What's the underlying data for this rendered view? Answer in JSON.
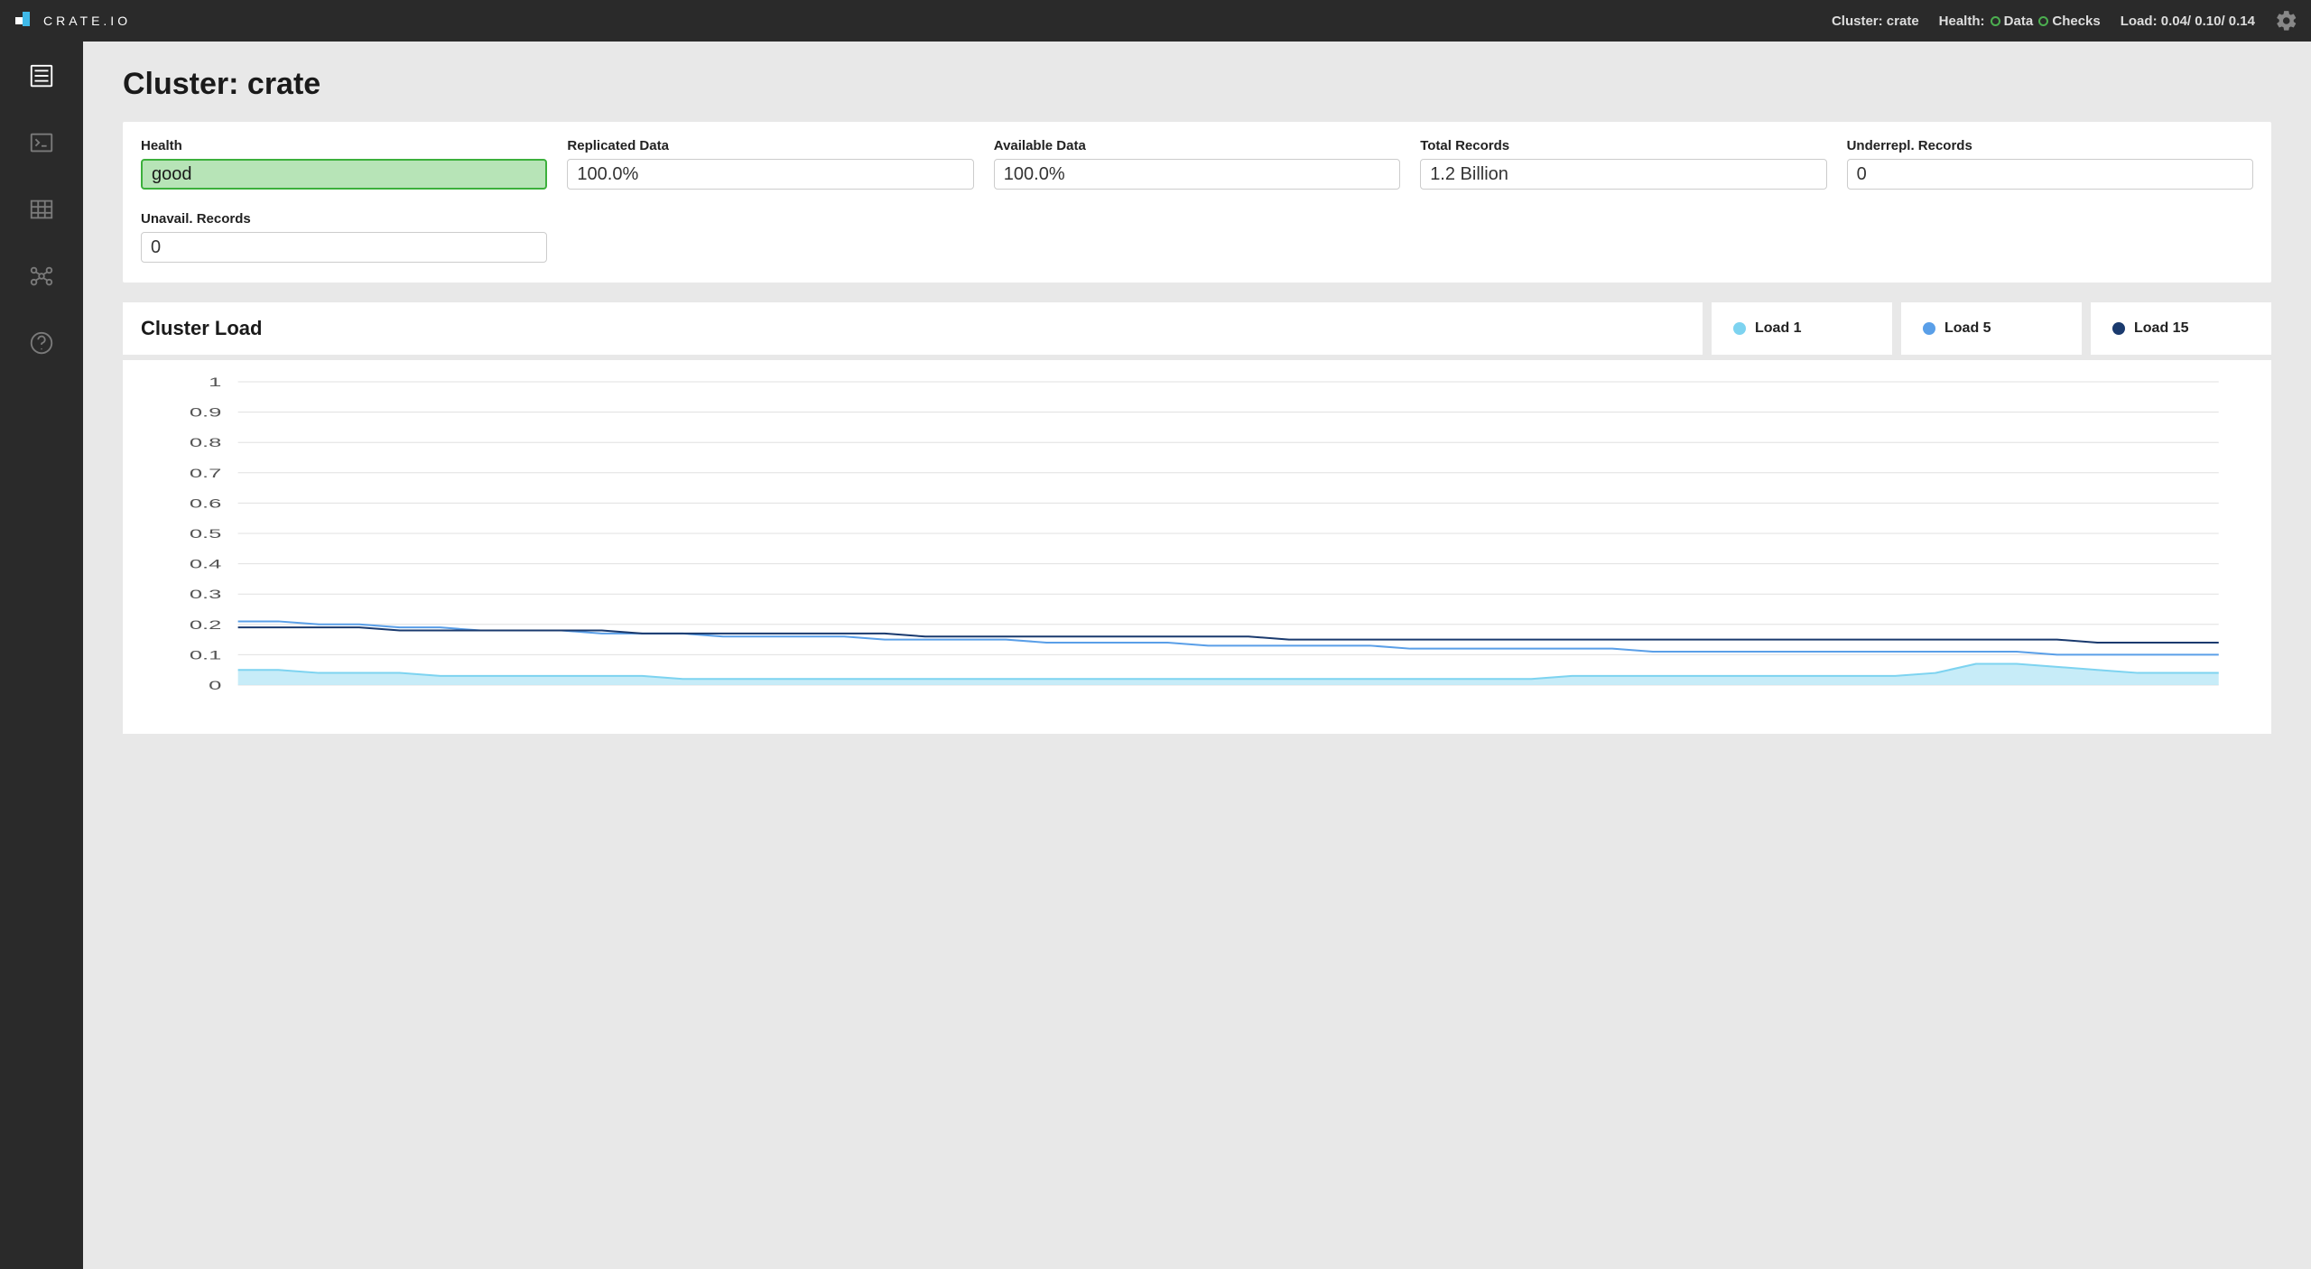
{
  "topbar": {
    "brand": "CRATE.IO",
    "cluster_label": "Cluster:",
    "cluster_name": "crate",
    "health_label": "Health:",
    "health_data": "Data",
    "health_checks": "Checks",
    "load_label": "Load:",
    "load_values": "0.04/ 0.10/ 0.14"
  },
  "sidebar": {
    "items": [
      {
        "name": "overview",
        "icon": "overview-icon",
        "active": true
      },
      {
        "name": "console",
        "icon": "console-icon",
        "active": false
      },
      {
        "name": "tables",
        "icon": "tables-icon",
        "active": false
      },
      {
        "name": "cluster",
        "icon": "cluster-icon",
        "active": false
      },
      {
        "name": "help",
        "icon": "help-icon",
        "active": false
      }
    ]
  },
  "page": {
    "title": "Cluster: crate"
  },
  "stats": [
    {
      "label": "Health",
      "value": "good",
      "kind": "health-good"
    },
    {
      "label": "Replicated Data",
      "value": "100.0%"
    },
    {
      "label": "Available Data",
      "value": "100.0%"
    },
    {
      "label": "Total Records",
      "value": "1.2 Billion"
    },
    {
      "label": "Underrepl. Records",
      "value": "0"
    },
    {
      "label": "Unavail. Records",
      "value": "0"
    }
  ],
  "chart": {
    "title": "Cluster Load",
    "legend": [
      {
        "label": "Load 1",
        "color": "#7dd3f0"
      },
      {
        "label": "Load 5",
        "color": "#5a9fe8"
      },
      {
        "label": "Load 15",
        "color": "#1a3a6e"
      }
    ]
  },
  "chart_data": {
    "type": "line",
    "title": "Cluster Load",
    "ylabel": "",
    "xlabel": "",
    "ylim": [
      0,
      1
    ],
    "yticks": [
      0,
      0.1,
      0.2,
      0.3,
      0.4,
      0.5,
      0.6,
      0.7,
      0.8,
      0.9,
      1
    ],
    "x": [
      0,
      1,
      2,
      3,
      4,
      5,
      6,
      7,
      8,
      9,
      10,
      11,
      12,
      13,
      14,
      15,
      16,
      17,
      18,
      19,
      20,
      21,
      22,
      23,
      24,
      25,
      26,
      27,
      28,
      29,
      30,
      31,
      32,
      33,
      34,
      35,
      36,
      37,
      38,
      39,
      40,
      41,
      42,
      43,
      44,
      45,
      46,
      47,
      48,
      49
    ],
    "series": [
      {
        "name": "Load 1",
        "color": "#7dd3f0",
        "fill": "#bde9f7",
        "values": [
          0.05,
          0.05,
          0.04,
          0.04,
          0.04,
          0.03,
          0.03,
          0.03,
          0.03,
          0.03,
          0.03,
          0.02,
          0.02,
          0.02,
          0.02,
          0.02,
          0.02,
          0.02,
          0.02,
          0.02,
          0.02,
          0.02,
          0.02,
          0.02,
          0.02,
          0.02,
          0.02,
          0.02,
          0.02,
          0.02,
          0.02,
          0.02,
          0.02,
          0.03,
          0.03,
          0.03,
          0.03,
          0.03,
          0.03,
          0.03,
          0.03,
          0.03,
          0.04,
          0.07,
          0.07,
          0.06,
          0.05,
          0.04,
          0.04,
          0.04
        ]
      },
      {
        "name": "Load 5",
        "color": "#5a9fe8",
        "values": [
          0.21,
          0.21,
          0.2,
          0.2,
          0.19,
          0.19,
          0.18,
          0.18,
          0.18,
          0.17,
          0.17,
          0.17,
          0.16,
          0.16,
          0.16,
          0.16,
          0.15,
          0.15,
          0.15,
          0.15,
          0.14,
          0.14,
          0.14,
          0.14,
          0.13,
          0.13,
          0.13,
          0.13,
          0.13,
          0.12,
          0.12,
          0.12,
          0.12,
          0.12,
          0.12,
          0.11,
          0.11,
          0.11,
          0.11,
          0.11,
          0.11,
          0.11,
          0.11,
          0.11,
          0.11,
          0.1,
          0.1,
          0.1,
          0.1,
          0.1
        ]
      },
      {
        "name": "Load 15",
        "color": "#1a3a6e",
        "values": [
          0.19,
          0.19,
          0.19,
          0.19,
          0.18,
          0.18,
          0.18,
          0.18,
          0.18,
          0.18,
          0.17,
          0.17,
          0.17,
          0.17,
          0.17,
          0.17,
          0.17,
          0.16,
          0.16,
          0.16,
          0.16,
          0.16,
          0.16,
          0.16,
          0.16,
          0.16,
          0.15,
          0.15,
          0.15,
          0.15,
          0.15,
          0.15,
          0.15,
          0.15,
          0.15,
          0.15,
          0.15,
          0.15,
          0.15,
          0.15,
          0.15,
          0.15,
          0.15,
          0.15,
          0.15,
          0.15,
          0.14,
          0.14,
          0.14,
          0.14
        ]
      }
    ]
  }
}
